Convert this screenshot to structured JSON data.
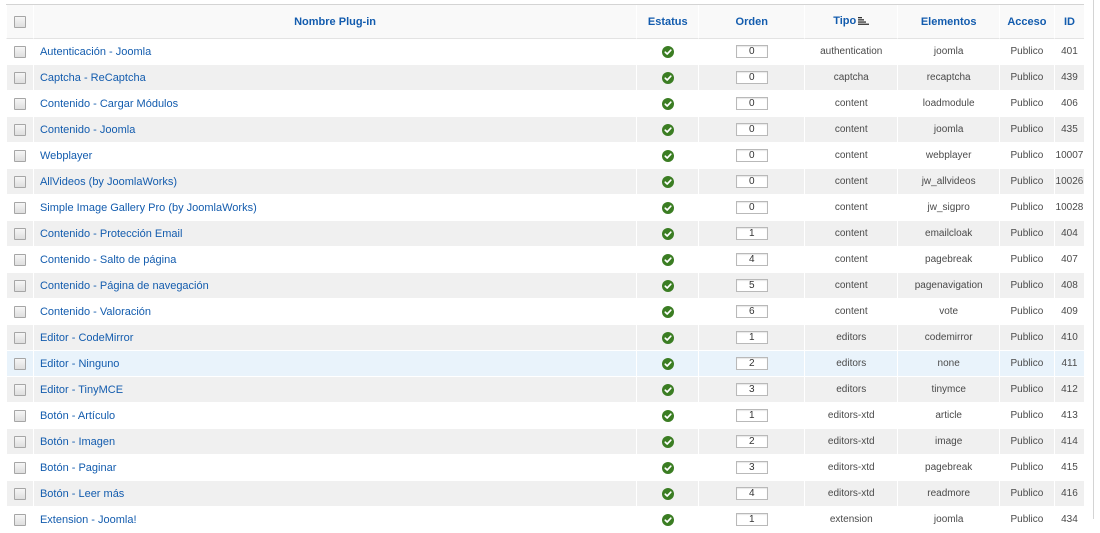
{
  "table": {
    "columns": {
      "name": "Nombre Plug-in",
      "status": "Estatus",
      "order": "Orden",
      "type": "Tipo",
      "elements": "Elementos",
      "access": "Acceso",
      "id": "ID"
    },
    "rows": [
      {
        "name": "Autenticación - Joomla",
        "order": "0",
        "type": "authentication",
        "element": "joomla",
        "access": "Publico",
        "id": "401"
      },
      {
        "name": "Captcha - ReCaptcha",
        "order": "0",
        "type": "captcha",
        "element": "recaptcha",
        "access": "Publico",
        "id": "439"
      },
      {
        "name": "Contenido - Cargar Módulos",
        "order": "0",
        "type": "content",
        "element": "loadmodule",
        "access": "Publico",
        "id": "406"
      },
      {
        "name": "Contenido - Joomla",
        "order": "0",
        "type": "content",
        "element": "joomla",
        "access": "Publico",
        "id": "435"
      },
      {
        "name": "Webplayer",
        "order": "0",
        "type": "content",
        "element": "webplayer",
        "access": "Publico",
        "id": "10007"
      },
      {
        "name": "AllVideos (by JoomlaWorks)",
        "order": "0",
        "type": "content",
        "element": "jw_allvideos",
        "access": "Publico",
        "id": "10026"
      },
      {
        "name": "Simple Image Gallery Pro (by JoomlaWorks)",
        "order": "0",
        "type": "content",
        "element": "jw_sigpro",
        "access": "Publico",
        "id": "10028"
      },
      {
        "name": "Contenido - Protección Email",
        "order": "1",
        "type": "content",
        "element": "emailcloak",
        "access": "Publico",
        "id": "404"
      },
      {
        "name": "Contenido - Salto de página",
        "order": "4",
        "type": "content",
        "element": "pagebreak",
        "access": "Publico",
        "id": "407"
      },
      {
        "name": "Contenido - Página de navegación",
        "order": "5",
        "type": "content",
        "element": "pagenavigation",
        "access": "Publico",
        "id": "408"
      },
      {
        "name": "Contenido - Valoración",
        "order": "6",
        "type": "content",
        "element": "vote",
        "access": "Publico",
        "id": "409"
      },
      {
        "name": "Editor - CodeMirror",
        "order": "1",
        "type": "editors",
        "element": "codemirror",
        "access": "Publico",
        "id": "410"
      },
      {
        "name": "Editor - Ninguno",
        "order": "2",
        "type": "editors",
        "element": "none",
        "access": "Publico",
        "id": "411"
      },
      {
        "name": "Editor - TinyMCE",
        "order": "3",
        "type": "editors",
        "element": "tinymce",
        "access": "Publico",
        "id": "412"
      },
      {
        "name": "Botón - Artículo",
        "order": "1",
        "type": "editors-xtd",
        "element": "article",
        "access": "Publico",
        "id": "413"
      },
      {
        "name": "Botón - Imagen",
        "order": "2",
        "type": "editors-xtd",
        "element": "image",
        "access": "Publico",
        "id": "414"
      },
      {
        "name": "Botón - Paginar",
        "order": "3",
        "type": "editors-xtd",
        "element": "pagebreak",
        "access": "Publico",
        "id": "415"
      },
      {
        "name": "Botón - Leer más",
        "order": "4",
        "type": "editors-xtd",
        "element": "readmore",
        "access": "Publico",
        "id": "416"
      },
      {
        "name": "Extension - Joomla!",
        "order": "1",
        "type": "extension",
        "element": "joomla",
        "access": "Publico",
        "id": "434"
      }
    ],
    "hover_row_index": 12
  },
  "icons": {
    "status": "check-circle-icon",
    "sort": "sort-ascending-icon",
    "checkbox": "checkbox"
  },
  "colors": {
    "link": "#135cae",
    "status_ok": "#3b7d23",
    "row_alt": "#f0f0f0",
    "row_hover": "#e9f3fb"
  }
}
